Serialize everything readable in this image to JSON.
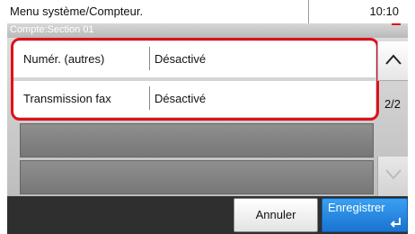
{
  "header": {
    "title": "Menu système/Compteur.",
    "time": "10:10",
    "subtitle": "Compte:Section 01"
  },
  "list": {
    "rows": [
      {
        "label": "Numér. (autres)",
        "value": "Désactivé"
      },
      {
        "label": "Transmission fax",
        "value": "Désactivé"
      }
    ]
  },
  "pagination": {
    "indicator": "2/2",
    "up_icon": "chevron-up-icon",
    "down_icon": "chevron-down-icon"
  },
  "footer": {
    "cancel_label": "Annuler",
    "save_label": "Enregistrer",
    "enter_icon": "enter-return-icon"
  },
  "colors": {
    "highlight": "#e0101a",
    "save_button": "#1a73d1"
  }
}
